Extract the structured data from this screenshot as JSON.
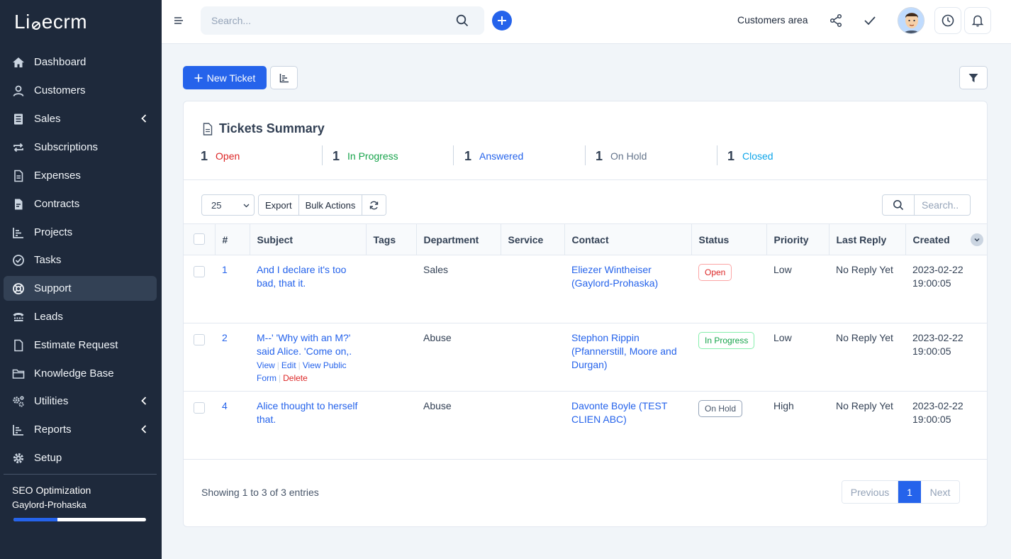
{
  "app": {
    "logo": "Li  ecrm"
  },
  "sidebar": {
    "items": [
      {
        "label": "Dashboard",
        "icon": "home-icon",
        "active": false
      },
      {
        "label": "Customers",
        "icon": "user-icon",
        "active": false
      },
      {
        "label": "Sales",
        "icon": "receipt-icon",
        "active": false,
        "has_submenu": true
      },
      {
        "label": "Subscriptions",
        "icon": "repeat-icon",
        "active": false
      },
      {
        "label": "Expenses",
        "icon": "file-text-icon",
        "active": false
      },
      {
        "label": "Contracts",
        "icon": "contract-icon",
        "active": false
      },
      {
        "label": "Projects",
        "icon": "chart-bar-icon",
        "active": false
      },
      {
        "label": "Tasks",
        "icon": "check-circle-icon",
        "active": false
      },
      {
        "label": "Support",
        "icon": "lifebuoy-icon",
        "active": true
      },
      {
        "label": "Leads",
        "icon": "tty-icon",
        "active": false
      },
      {
        "label": "Estimate Request",
        "icon": "file-icon",
        "active": false
      },
      {
        "label": "Knowledge Base",
        "icon": "folder-icon",
        "active": false
      },
      {
        "label": "Utilities",
        "icon": "cogs-icon",
        "active": false,
        "has_submenu": true
      },
      {
        "label": "Reports",
        "icon": "chart-bar-icon",
        "active": false,
        "has_submenu": true
      },
      {
        "label": "Setup",
        "icon": "gear-icon",
        "active": false
      }
    ],
    "project": {
      "title": "SEO Optimization",
      "client": "Gaylord-Prohaska",
      "progress": 0.33
    }
  },
  "topbar": {
    "search_placeholder": "Search...",
    "customers_area": "Customers area"
  },
  "actions": {
    "new_ticket": "New Ticket"
  },
  "summary": {
    "title": "Tickets Summary",
    "items": [
      {
        "count": "1",
        "label": "Open",
        "color": "#dc2626"
      },
      {
        "count": "1",
        "label": "In Progress",
        "color": "#16a34a"
      },
      {
        "count": "1",
        "label": "Answered",
        "color": "#2563eb"
      },
      {
        "count": "1",
        "label": "On Hold",
        "color": "#64748b"
      },
      {
        "count": "1",
        "label": "Closed",
        "color": "#0ea5e9"
      }
    ]
  },
  "table_controls": {
    "page_length": "25",
    "export": "Export",
    "bulk_actions": "Bulk Actions",
    "search_placeholder": "Search.."
  },
  "table": {
    "headers": [
      "#",
      "Subject",
      "Tags",
      "Department",
      "Service",
      "Contact",
      "Status",
      "Priority",
      "Last Reply",
      "Created"
    ],
    "rows": [
      {
        "id": "1",
        "subject": "And I declare it's too bad, that it.",
        "tags": "",
        "department": "Sales",
        "service": "",
        "contact": "Eliezer Wintheiser (Gaylord-Prohaska)",
        "status": "Open",
        "status_color": "#dc2626",
        "priority": "Low",
        "last_reply": "No Reply Yet",
        "created": "2023-02-22 19:00:05"
      },
      {
        "id": "2",
        "subject": "M--' 'Why with an M?' said Alice. 'Come on,.",
        "tags": "",
        "department": "Abuse",
        "service": "",
        "contact": "Stephon Rippin (Pfannerstill, Moore and Durgan)",
        "status": "In Progress",
        "status_color": "#16a34a",
        "priority": "Low",
        "last_reply": "No Reply Yet",
        "created": "2023-02-22 19:00:05",
        "row_actions": {
          "view": "View",
          "edit": "Edit",
          "view_public": "View Public Form",
          "delete": "Delete"
        }
      },
      {
        "id": "4",
        "subject": "Alice thought to herself that.",
        "tags": "",
        "department": "Abuse",
        "service": "",
        "contact": "Davonte Boyle (TEST CLIEN ABC)",
        "status": "On Hold",
        "status_color": "#475569",
        "priority": "High",
        "last_reply": "No Reply Yet",
        "created": "2023-02-22 19:00:05"
      }
    ]
  },
  "footer": {
    "showing": "Showing 1 to 3 of 3 entries",
    "previous": "Previous",
    "page": "1",
    "next": "Next"
  }
}
